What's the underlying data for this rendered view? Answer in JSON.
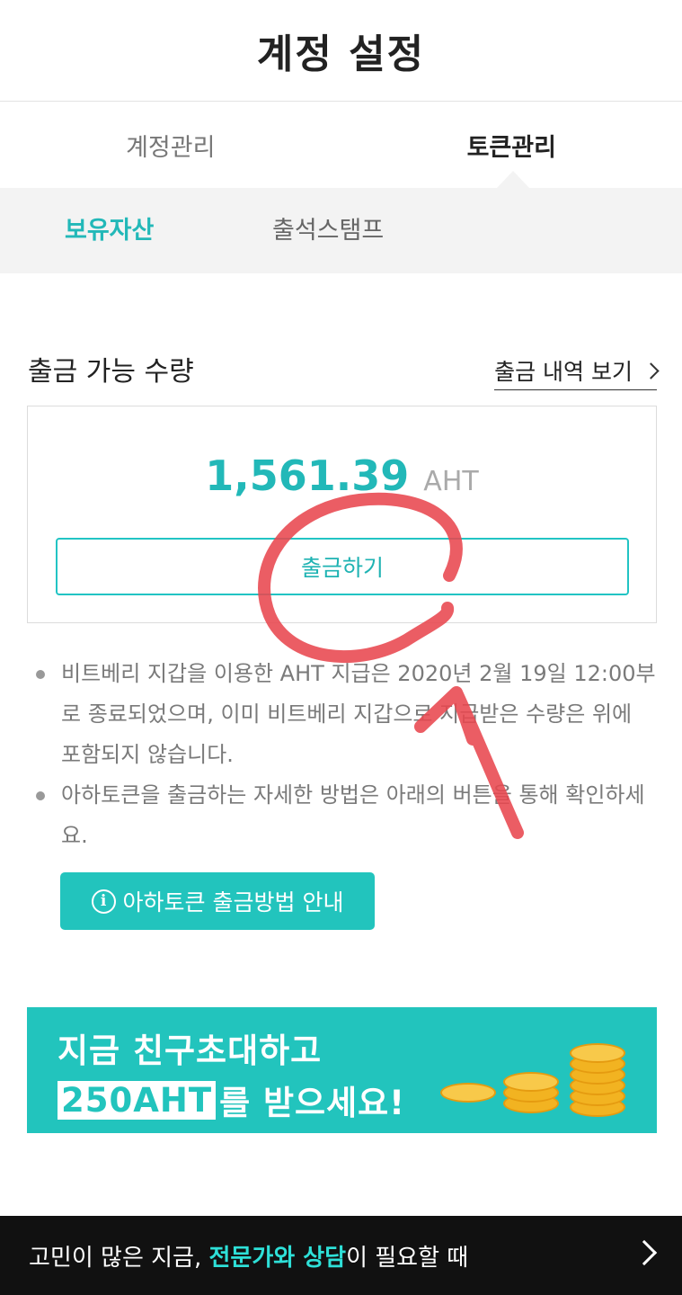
{
  "header": {
    "title": "계정 설정"
  },
  "main_tabs": [
    {
      "label": "계정관리",
      "active": false
    },
    {
      "label": "토큰관리",
      "active": true
    }
  ],
  "sub_tabs": [
    {
      "label": "보유자산",
      "active": true
    },
    {
      "label": "출석스탬프",
      "active": false
    }
  ],
  "withdrawable": {
    "title": "출금 가능 수량",
    "history_link": "출금 내역 보기",
    "amount": "1,561.39",
    "unit": "AHT",
    "withdraw_button": "출금하기"
  },
  "notes": [
    "비트베리 지갑을 이용한 AHT 지급은 2020년 2월 19일 12:00부로 종료되었으며, 이미 비트베리 지갑으로 지급받은 수량은 위에 포함되지 않습니다.",
    "아하토큰을 출금하는 자세한 방법은 아래의 버튼을 통해 확인하세요."
  ],
  "guide_button": {
    "label": "아하토큰 출금방법 안내",
    "icon": "info-icon"
  },
  "banner": {
    "line1": "지금 친구초대하고",
    "line2_highlight": "250AHT",
    "line2_rest": "를 받으세요!"
  },
  "bottom_bar": {
    "prefix": "고민이 많은 지금, ",
    "accent": "전문가와 상담",
    "suffix": "이 필요할 때",
    "icon": "chevron-right-icon"
  },
  "colors": {
    "accent": "#22c4bd",
    "annotation": "#e8474f"
  }
}
